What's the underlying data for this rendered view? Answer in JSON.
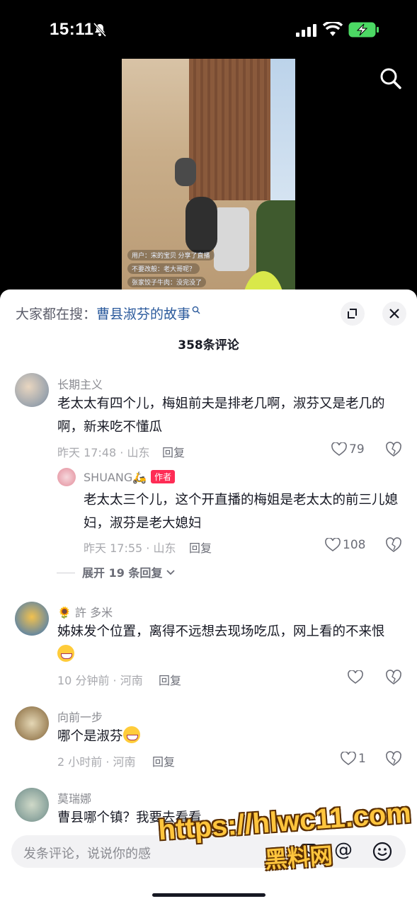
{
  "status_bar": {
    "time": "15:11"
  },
  "header": {
    "everyone_searching_label": "大家都在搜：",
    "search_keyword": "曹县淑芬的故事",
    "comment_count": "358条评论"
  },
  "video": {
    "live_messages": [
      "用户：宋的宝贝 分享了直播",
      "不要改般：老大哥呢？",
      "张家饺子牛肉：没完没了"
    ]
  },
  "comments": [
    {
      "username": "长期主义",
      "text": "老太太有四个儿，梅姐前夫是排老几啊，淑芬又是老几的啊，新来吃不懂瓜",
      "meta": "昨天 17:48 · 山东",
      "reply_label": "回复",
      "likes": "79",
      "replies": [
        {
          "username": "SHUANG🛵",
          "author_badge": "作者",
          "text": "老太太三个儿，这个开直播的梅姐是老太太的前三儿媳妇，淑芬是老大媳妇",
          "meta": "昨天 17:55 · 山东",
          "reply_label": "回复",
          "likes": "108"
        }
      ],
      "expand_label": "展开 19 条回复"
    },
    {
      "username": "🌻 許 多米",
      "text": "姊妹发个位置，离得不远想去现场吃瓜，网上看的不来恨",
      "meta": "10 分钟前 · 河南",
      "reply_label": "回复",
      "likes": ""
    },
    {
      "username": "向前一步",
      "text": "哪个是淑芬",
      "meta": "2 小时前 · 河南",
      "reply_label": "回复",
      "likes": "1"
    },
    {
      "username": "莫瑞娜",
      "text": "曹县哪个镇？我要去看看"
    }
  ],
  "input_bar": {
    "placeholder": "发条评论，说说你的感"
  },
  "watermark": {
    "url": "https://hlwc11.com",
    "brand": "黑料网"
  },
  "colors": {
    "accent": "#fe2c55",
    "link": "#2b5a9c",
    "watermark": "#ffc53d"
  }
}
